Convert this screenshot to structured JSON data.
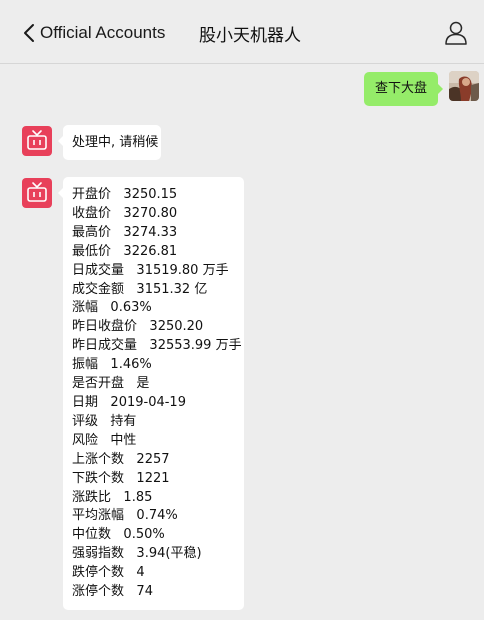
{
  "header": {
    "back_label": "Official Accounts",
    "title": "股小天机器人",
    "profile_icon": "person-icon"
  },
  "messages": {
    "user_query": "查下大盘",
    "bot_processing": "处理中, 请稍候",
    "stats": [
      {
        "label": "开盘价",
        "value": "3250.15"
      },
      {
        "label": "收盘价",
        "value": "3270.80"
      },
      {
        "label": "最高价",
        "value": "3274.33"
      },
      {
        "label": "最低价",
        "value": "3226.81"
      },
      {
        "label": "日成交量",
        "value": "31519.80 万手"
      },
      {
        "label": "成交金额",
        "value": "3151.32 亿"
      },
      {
        "label": "涨幅",
        "value": "0.63%"
      },
      {
        "label": "昨日收盘价",
        "value": "3250.20"
      },
      {
        "label": "昨日成交量",
        "value": "32553.99 万手"
      },
      {
        "label": "振幅",
        "value": "1.46%"
      },
      {
        "label": "是否开盘",
        "value": "是"
      },
      {
        "label": "日期",
        "value": "2019-04-19"
      },
      {
        "label": "评级",
        "value": "持有"
      },
      {
        "label": "风险",
        "value": "中性"
      },
      {
        "label": "上涨个数",
        "value": "2257"
      },
      {
        "label": "下跌个数",
        "value": "1221"
      },
      {
        "label": "涨跌比",
        "value": "1.85"
      },
      {
        "label": "平均涨幅",
        "value": "0.74%"
      },
      {
        "label": "中位数",
        "value": "0.50%"
      },
      {
        "label": "强弱指数",
        "value": "3.94(平稳)"
      },
      {
        "label": "跌停个数",
        "value": "4"
      },
      {
        "label": "涨停个数",
        "value": "74"
      }
    ]
  },
  "colors": {
    "background": "#ededed",
    "bubble_user": "#95ec69",
    "bubble_bot": "#ffffff",
    "bot_avatar": "#e8405a"
  }
}
